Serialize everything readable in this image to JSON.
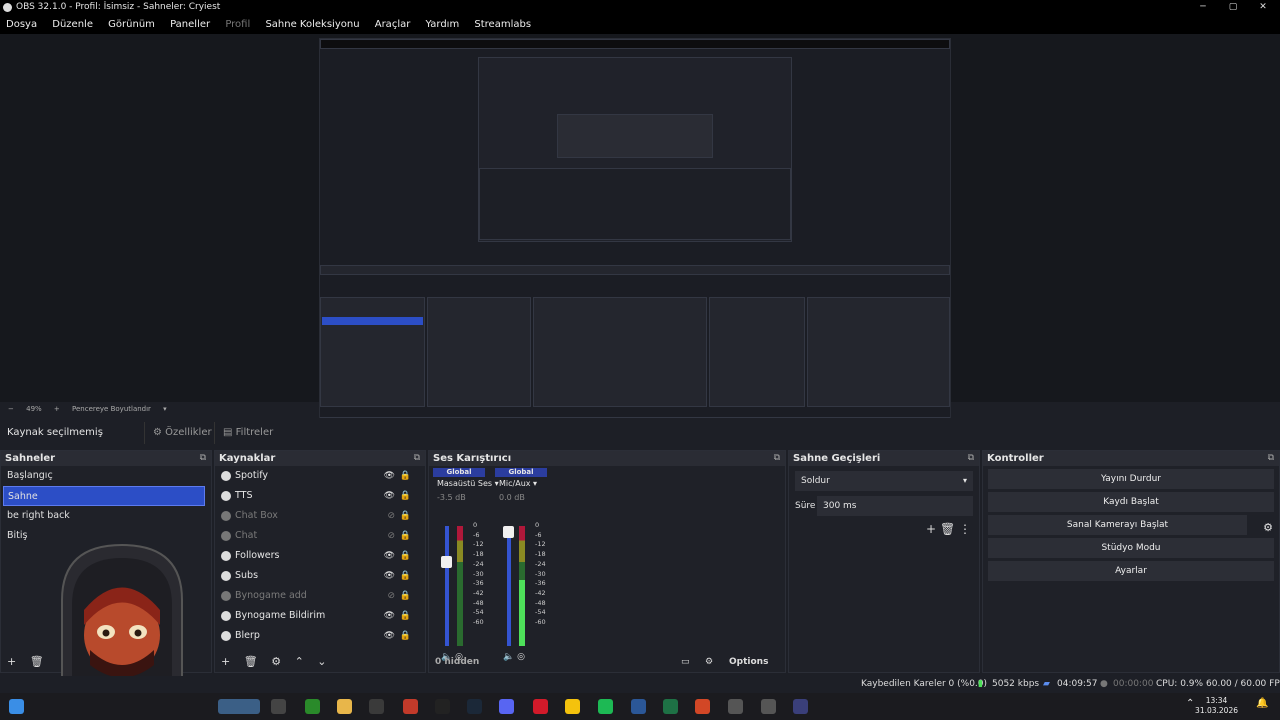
{
  "window": {
    "title": "OBS 32.1.0 - Profil: İsimsiz - Sahneler: Cryiest",
    "minimize": "─",
    "maximize": "▢",
    "close": "✕"
  },
  "menu": [
    "Dosya",
    "Düzenle",
    "Görünüm",
    "Paneller",
    "Profil",
    "Sahne Koleksiyonu",
    "Araçlar",
    "Yardım",
    "Streamlabs"
  ],
  "preview": {
    "zoom": "49%",
    "fit": "Pencereye Boyutlandır"
  },
  "source_bar": {
    "no_selection": "Kaynak seçilmemiş",
    "properties": "Özellikler",
    "filters": "Filtreler"
  },
  "scenes": {
    "title": "Sahneler",
    "items": [
      "Başlangıç",
      "Sahne",
      "be right back",
      "Bitiş"
    ],
    "selected_index": 1
  },
  "sources": {
    "title": "Kaynaklar",
    "items": [
      {
        "name": "Spotify",
        "visible": true
      },
      {
        "name": "TTS",
        "visible": true
      },
      {
        "name": "Chat Box",
        "visible": false
      },
      {
        "name": "Chat",
        "visible": false
      },
      {
        "name": "Followers",
        "visible": true
      },
      {
        "name": "Subs",
        "visible": true
      },
      {
        "name": "Bynogame add",
        "visible": false
      },
      {
        "name": "Bynogame Bildirim",
        "visible": true
      },
      {
        "name": "Blerp",
        "visible": true
      }
    ]
  },
  "mixer": {
    "title": "Ses Karıştırıcı",
    "channels": [
      {
        "badge": "Global",
        "name": "Masaüstü Ses",
        "db": "-3.5 dB",
        "level": 0.0
      },
      {
        "badge": "Global",
        "name": "Mic/Aux",
        "db": "0.0 dB",
        "level": 0.55
      }
    ],
    "scale": [
      "0",
      "-6",
      "-12",
      "-18",
      "-24",
      "-30",
      "-36",
      "-42",
      "-48",
      "-54",
      "-60"
    ],
    "hidden": "0 hidden",
    "options": "Options"
  },
  "transitions": {
    "title": "Sahne Geçişleri",
    "type": "Soldur",
    "duration_label": "Süre",
    "duration": "300 ms"
  },
  "controls": {
    "title": "Kontroller",
    "buttons": [
      "Yayını Durdur",
      "Kaydı Başlat",
      "Sanal Kamerayı Başlat",
      "Stüdyo Modu",
      "Ayarlar"
    ]
  },
  "status": {
    "dropped": "Kaybedilen Kareler 0 (%0.0)",
    "bitrate": "5052 kbps",
    "stream_time": "04:09:57",
    "record_time": "00:00:00",
    "cpu": "CPU: 0.9%",
    "fps": "60.00 / 60.00 FPS"
  },
  "clock": {
    "time": "13:34",
    "date": "31.03.2026"
  },
  "colors": {
    "accent": "#2c4ec6",
    "meter_green": "#4ee05a"
  }
}
